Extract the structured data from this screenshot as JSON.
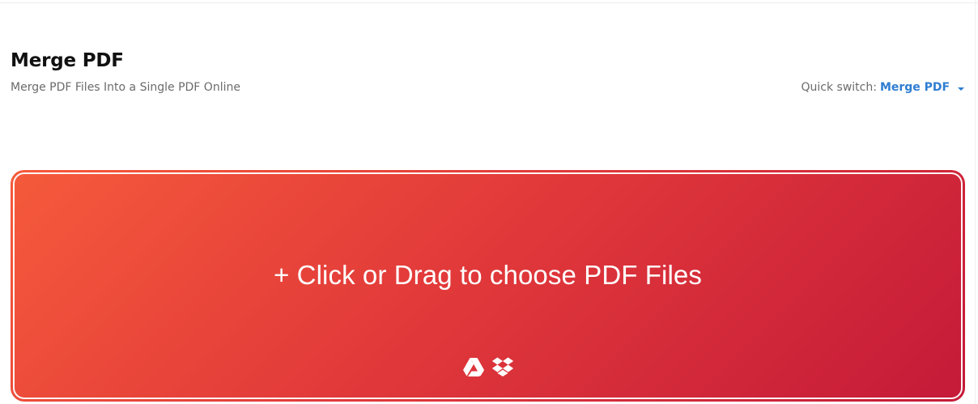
{
  "header": {
    "title": "Merge PDF",
    "subtitle": "Merge PDF Files Into a Single PDF Online"
  },
  "quick_switch": {
    "label": "Quick switch:",
    "value": "Merge PDF",
    "icon": "caret-down-icon"
  },
  "dropzone": {
    "label": "+ Click or Drag to choose PDF Files",
    "gradient_colors": [
      "#f55a3b",
      "#c51a39"
    ],
    "cloud_sources": [
      {
        "icon": "google-drive-icon"
      },
      {
        "icon": "dropbox-icon"
      }
    ]
  }
}
